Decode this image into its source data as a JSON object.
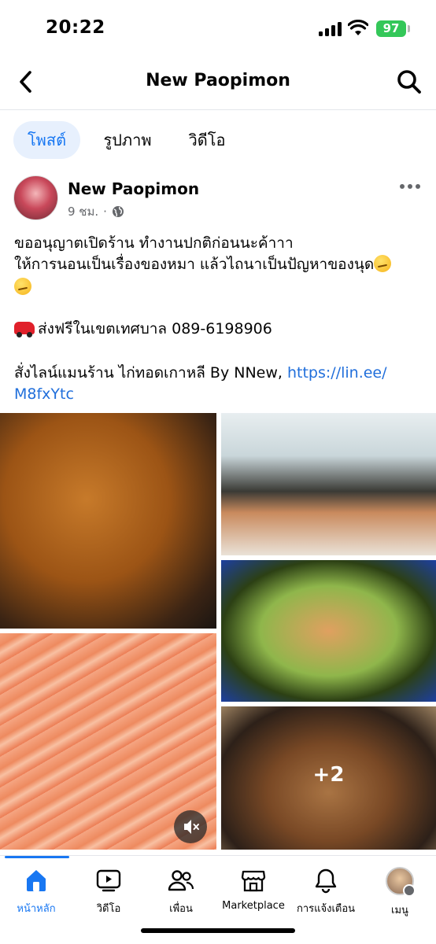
{
  "status_bar": {
    "time": "20:22",
    "battery": "97"
  },
  "header": {
    "title": "New Paopimon",
    "back_icon": "chevron-left-icon",
    "search_icon": "search-icon"
  },
  "tabs": [
    {
      "label": "โพสต์",
      "active": true
    },
    {
      "label": "รูปภาพ",
      "active": false
    },
    {
      "label": "วิดีโอ",
      "active": false
    }
  ],
  "post": {
    "author": "New Paopimon",
    "time": "9 ชม.",
    "separator": "·",
    "privacy_icon": "globe-icon",
    "lines": {
      "l1": "ขออนุญาตเปิดร้าน ทำงานปกติก่อนนะค้าาา",
      "l2": "ให้การนอนเป็นเรื่องของหมา แล้วไถนาเป็นปัญหาของนุด",
      "l3": "ส่งฟรีในเขตเทศบาล 089-6198906",
      "l4": "สั่งไลน์แมนร้าน ไก่ทอดเกาหลี By NNew, ",
      "link_part1": "https://lin.ee/",
      "link_part2": "M8fxYtc"
    },
    "more_photos": "+2"
  },
  "bottom_nav": [
    {
      "label": "หน้าหลัก",
      "icon": "home-icon",
      "active": true
    },
    {
      "label": "วิดีโอ",
      "icon": "video-icon",
      "active": false
    },
    {
      "label": "เพื่อน",
      "icon": "friends-icon",
      "active": false
    },
    {
      "label": "Marketplace",
      "icon": "marketplace-icon",
      "active": false
    },
    {
      "label": "การแจ้งเตือน",
      "icon": "bell-icon",
      "active": false
    },
    {
      "label": "เมนู",
      "icon": "menu-avatar-icon",
      "active": false
    }
  ],
  "colors": {
    "accent": "#1877f2",
    "link": "#216fdb",
    "battery": "#34c759"
  }
}
